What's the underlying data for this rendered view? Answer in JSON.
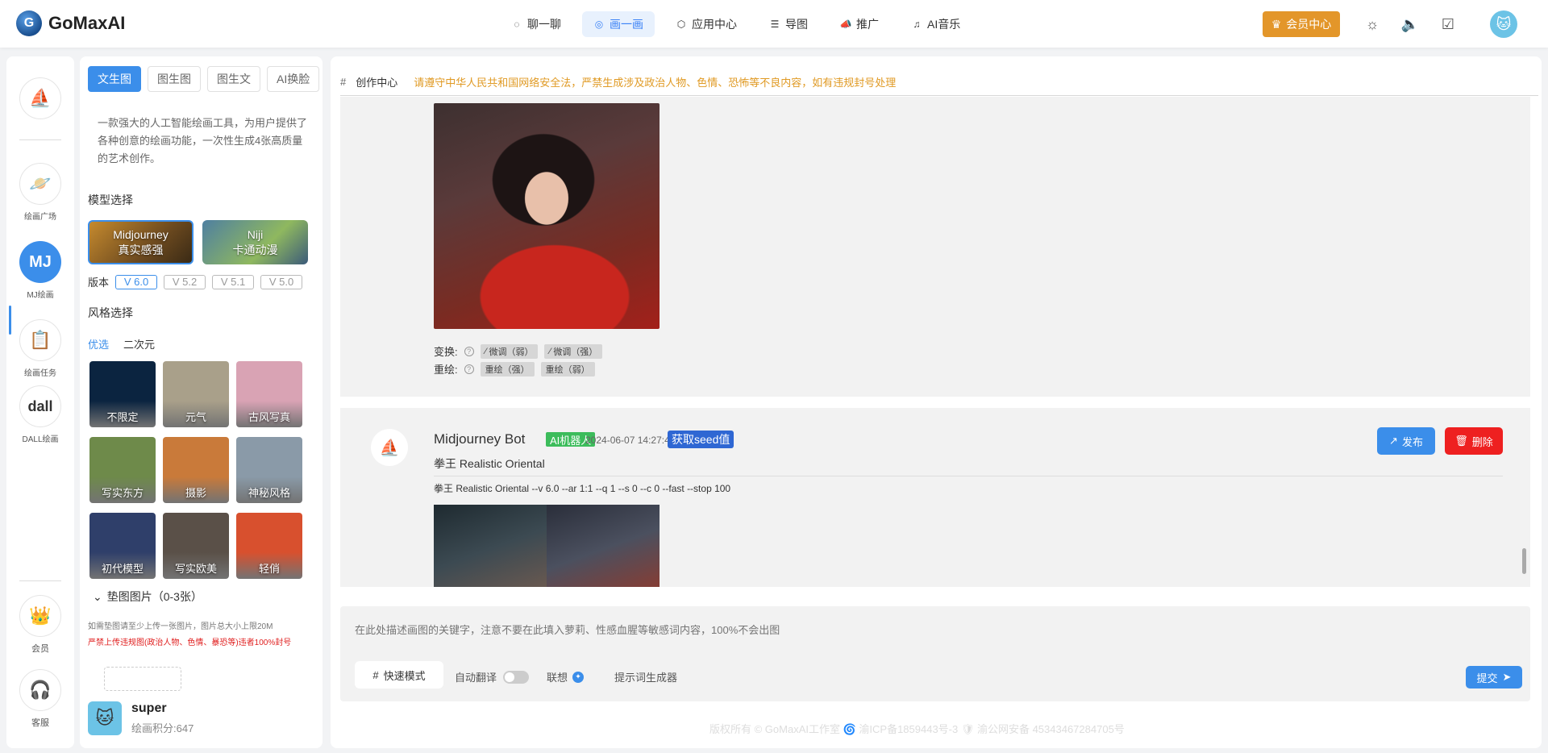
{
  "app": {
    "name": "GoMaxAI",
    "logo_letter": "G"
  },
  "nav": [
    {
      "label": "聊一聊",
      "icon": "chat-icon",
      "glyph": "◌"
    },
    {
      "label": "画一画",
      "icon": "palette-icon",
      "glyph": "◎",
      "active": true
    },
    {
      "label": "应用中心",
      "icon": "cube-icon",
      "glyph": "⬡"
    },
    {
      "label": "导图",
      "icon": "mindmap-icon",
      "glyph": "☰"
    },
    {
      "label": "推广",
      "icon": "megaphone-icon",
      "glyph": "📣"
    },
    {
      "label": "AI音乐",
      "icon": "music-icon",
      "glyph": "♫"
    }
  ],
  "header_right": {
    "vip_label": "会员中心",
    "theme_glyph": "☼",
    "sound_glyph": "🔈",
    "checkin_glyph": "☑",
    "avatar_glyph": "🐱"
  },
  "rail": {
    "logo_glyph": "⛵",
    "items": [
      {
        "label": "绘画广场",
        "glyph": "🪐"
      },
      {
        "label": "MJ绘画",
        "glyph": "MJ",
        "active": true
      },
      {
        "label": "绘画任务",
        "glyph": "📋"
      },
      {
        "label": "DALL绘画",
        "glyph": "dall"
      }
    ],
    "bottom": [
      {
        "label": "会员",
        "glyph": "👑"
      },
      {
        "label": "客服",
        "glyph": "🎧"
      }
    ]
  },
  "panel": {
    "tabs": [
      {
        "label": "文生图",
        "active": true
      },
      {
        "label": "图生图"
      },
      {
        "label": "图生文"
      },
      {
        "label": "AI换脸"
      }
    ],
    "description": "一款强大的人工智能绘画工具，为用户提供了各种创意的绘画功能，一次性生成4张高质量的艺术创作。",
    "model_title": "模型选择",
    "models": [
      {
        "name": "Midjourney",
        "sub": "真实感强",
        "active": true
      },
      {
        "name": "Niji",
        "sub": "卡通动漫"
      }
    ],
    "version_label": "版本",
    "versions": [
      "V 6.0",
      "V 5.2",
      "V 5.1",
      "V 5.0"
    ],
    "active_version": "V 6.0",
    "style_title": "风格选择",
    "style_tabs": [
      {
        "label": "优选",
        "active": true
      },
      {
        "label": "二次元"
      }
    ],
    "styles": [
      {
        "label": "不限定",
        "bg": "#0b2440"
      },
      {
        "label": "元气",
        "bg": "#a9a08a"
      },
      {
        "label": "古风写真",
        "bg": "#d9a3b4"
      },
      {
        "label": "写实东方",
        "bg": "#6e8a4a"
      },
      {
        "label": "摄影",
        "bg": "#c97a3a"
      },
      {
        "label": "神秘风格",
        "bg": "#8a9aa8"
      },
      {
        "label": "初代模型",
        "bg": "#2f3f6a"
      },
      {
        "label": "写实欧美",
        "bg": "#5a5048"
      },
      {
        "label": "轻俏",
        "bg": "#d8502e"
      }
    ],
    "upload_title": "垫图图片（0-3张）",
    "upload_note": "如需垫图请至少上传一张图片，图片总大小上限20M",
    "upload_warning": "严禁上传违规图(政治人物、色情、暴恐等)违者100%封号"
  },
  "user": {
    "name": "super",
    "points": "绘画积分:647",
    "avatar_glyph": "🐱"
  },
  "main": {
    "hash": "#",
    "title": "创作中心",
    "warning": "请遵守中华人民共和国网络安全法，严禁生成涉及政治人物、色情、恐怖等不良内容，如有违规封号处理",
    "variation_label": "变换:",
    "variation_actions": [
      "微调（弱）",
      "微调（强）"
    ],
    "redraw_label": "重绘:",
    "redraw_actions": [
      "重绘（强）",
      "重绘（弱）"
    ],
    "message": {
      "bot_name": "Midjourney Bot",
      "bot_badge": "AI机器人",
      "time": "2024-06-07 14:27:41",
      "seed_label": "获取seed值",
      "publish_label": "发布",
      "delete_label": "删除",
      "prompt": "拳王 Realistic Oriental",
      "params": "拳王 Realistic Oriental --v 6.0 --ar 1:1 --q 1 --s 0 --c 0 --fast --stop 100"
    }
  },
  "input": {
    "placeholder": "在此处描述画图的关键字，注意不要在此填入萝莉、性感血腥等敏感词内容，100%不会出图",
    "quick_mode": "快速模式",
    "auto_translate": "自动翻译",
    "auto_translate_on": false,
    "associate": "联想",
    "prompt_generator": "提示词生成器",
    "submit": "提交"
  },
  "footer": "版权所有 © GoMaxAI工作室 🌀 渝ICP备1859443号-3 🛡 渝公网安备 45343467284705号"
}
